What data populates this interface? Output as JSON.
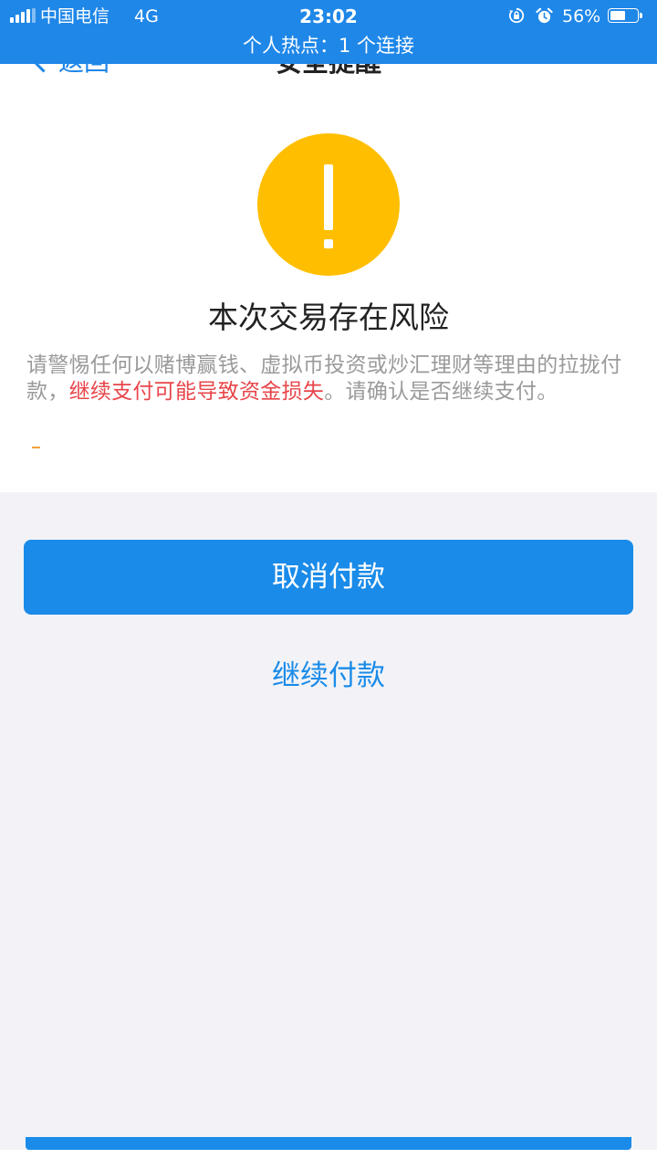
{
  "status_bar": {
    "carrier": "中国电信",
    "network": "4G",
    "time": "23:02",
    "battery_percent": "56%",
    "battery_level": 0.56,
    "hotspot": "个人热点：1 个连接",
    "icons": [
      "signal-icon",
      "rotation-lock-icon",
      "alarm-icon",
      "battery-icon"
    ]
  },
  "nav": {
    "back_label": "返回",
    "title": "安全提醒"
  },
  "alert": {
    "icon": "warning-icon",
    "title": "本次交易存在风险",
    "desc_before": "请警惕任何以赌博赢钱、虚拟币投资或炒汇理财等理由的拉拢付款，",
    "desc_warning": "继续支付可能导致资金损失",
    "desc_after": "。请确认是否继续支付。"
  },
  "actions": {
    "cancel_label": "取消付款",
    "continue_label": "继续付款"
  },
  "colors": {
    "status_bar": "#1f87e8",
    "primary": "#1a8be9",
    "warning_icon": "#ffbf00",
    "warning_text": "#e8454a",
    "page_background": "#f3f3f7"
  }
}
